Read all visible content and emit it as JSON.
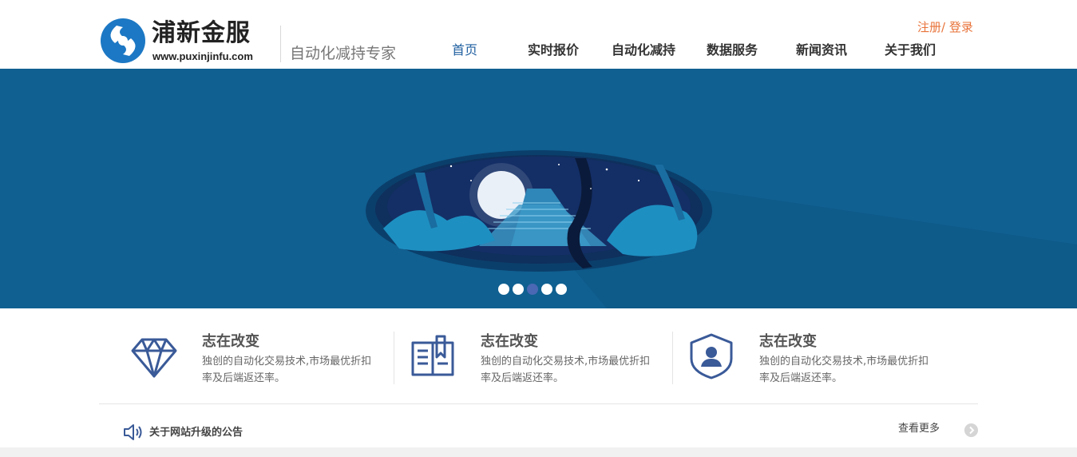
{
  "header": {
    "brand_name": "浦新金服",
    "brand_url": "www.puxinjinfu.com",
    "tagline": "自动化减持专家",
    "auth": {
      "register": "注册",
      "separator": "/ ",
      "login": "登录"
    },
    "nav": [
      {
        "label": "首页",
        "active": true
      },
      {
        "label": "实时报价",
        "active": false
      },
      {
        "label": "自动化减持",
        "active": false
      },
      {
        "label": "数据服务",
        "active": false
      },
      {
        "label": "新闻资讯",
        "active": false
      },
      {
        "label": "关于我们",
        "active": false
      }
    ]
  },
  "banner": {
    "slide_count": 5,
    "active_slide": 3
  },
  "features": [
    {
      "icon": "diamond-icon",
      "title": "志在改变",
      "desc": "独创的自动化交易技术,市场最优折扣 率及后端返还率。"
    },
    {
      "icon": "book-icon",
      "title": "志在改变",
      "desc": "独创的自动化交易技术,市场最优折扣 率及后端返还率。"
    },
    {
      "icon": "shield-user-icon",
      "title": "志在改变",
      "desc": "独创的自动化交易技术,市场最优折扣 率及后端返还率。"
    }
  ],
  "notice": {
    "text": "关于网站升级的公告",
    "more": "查看更多"
  },
  "colors": {
    "accent": "#1f5fa0",
    "auth": "#e8733a",
    "banner_bg": "#106091",
    "icon": "#3a5a98",
    "dot_active": "#4a68b4"
  }
}
